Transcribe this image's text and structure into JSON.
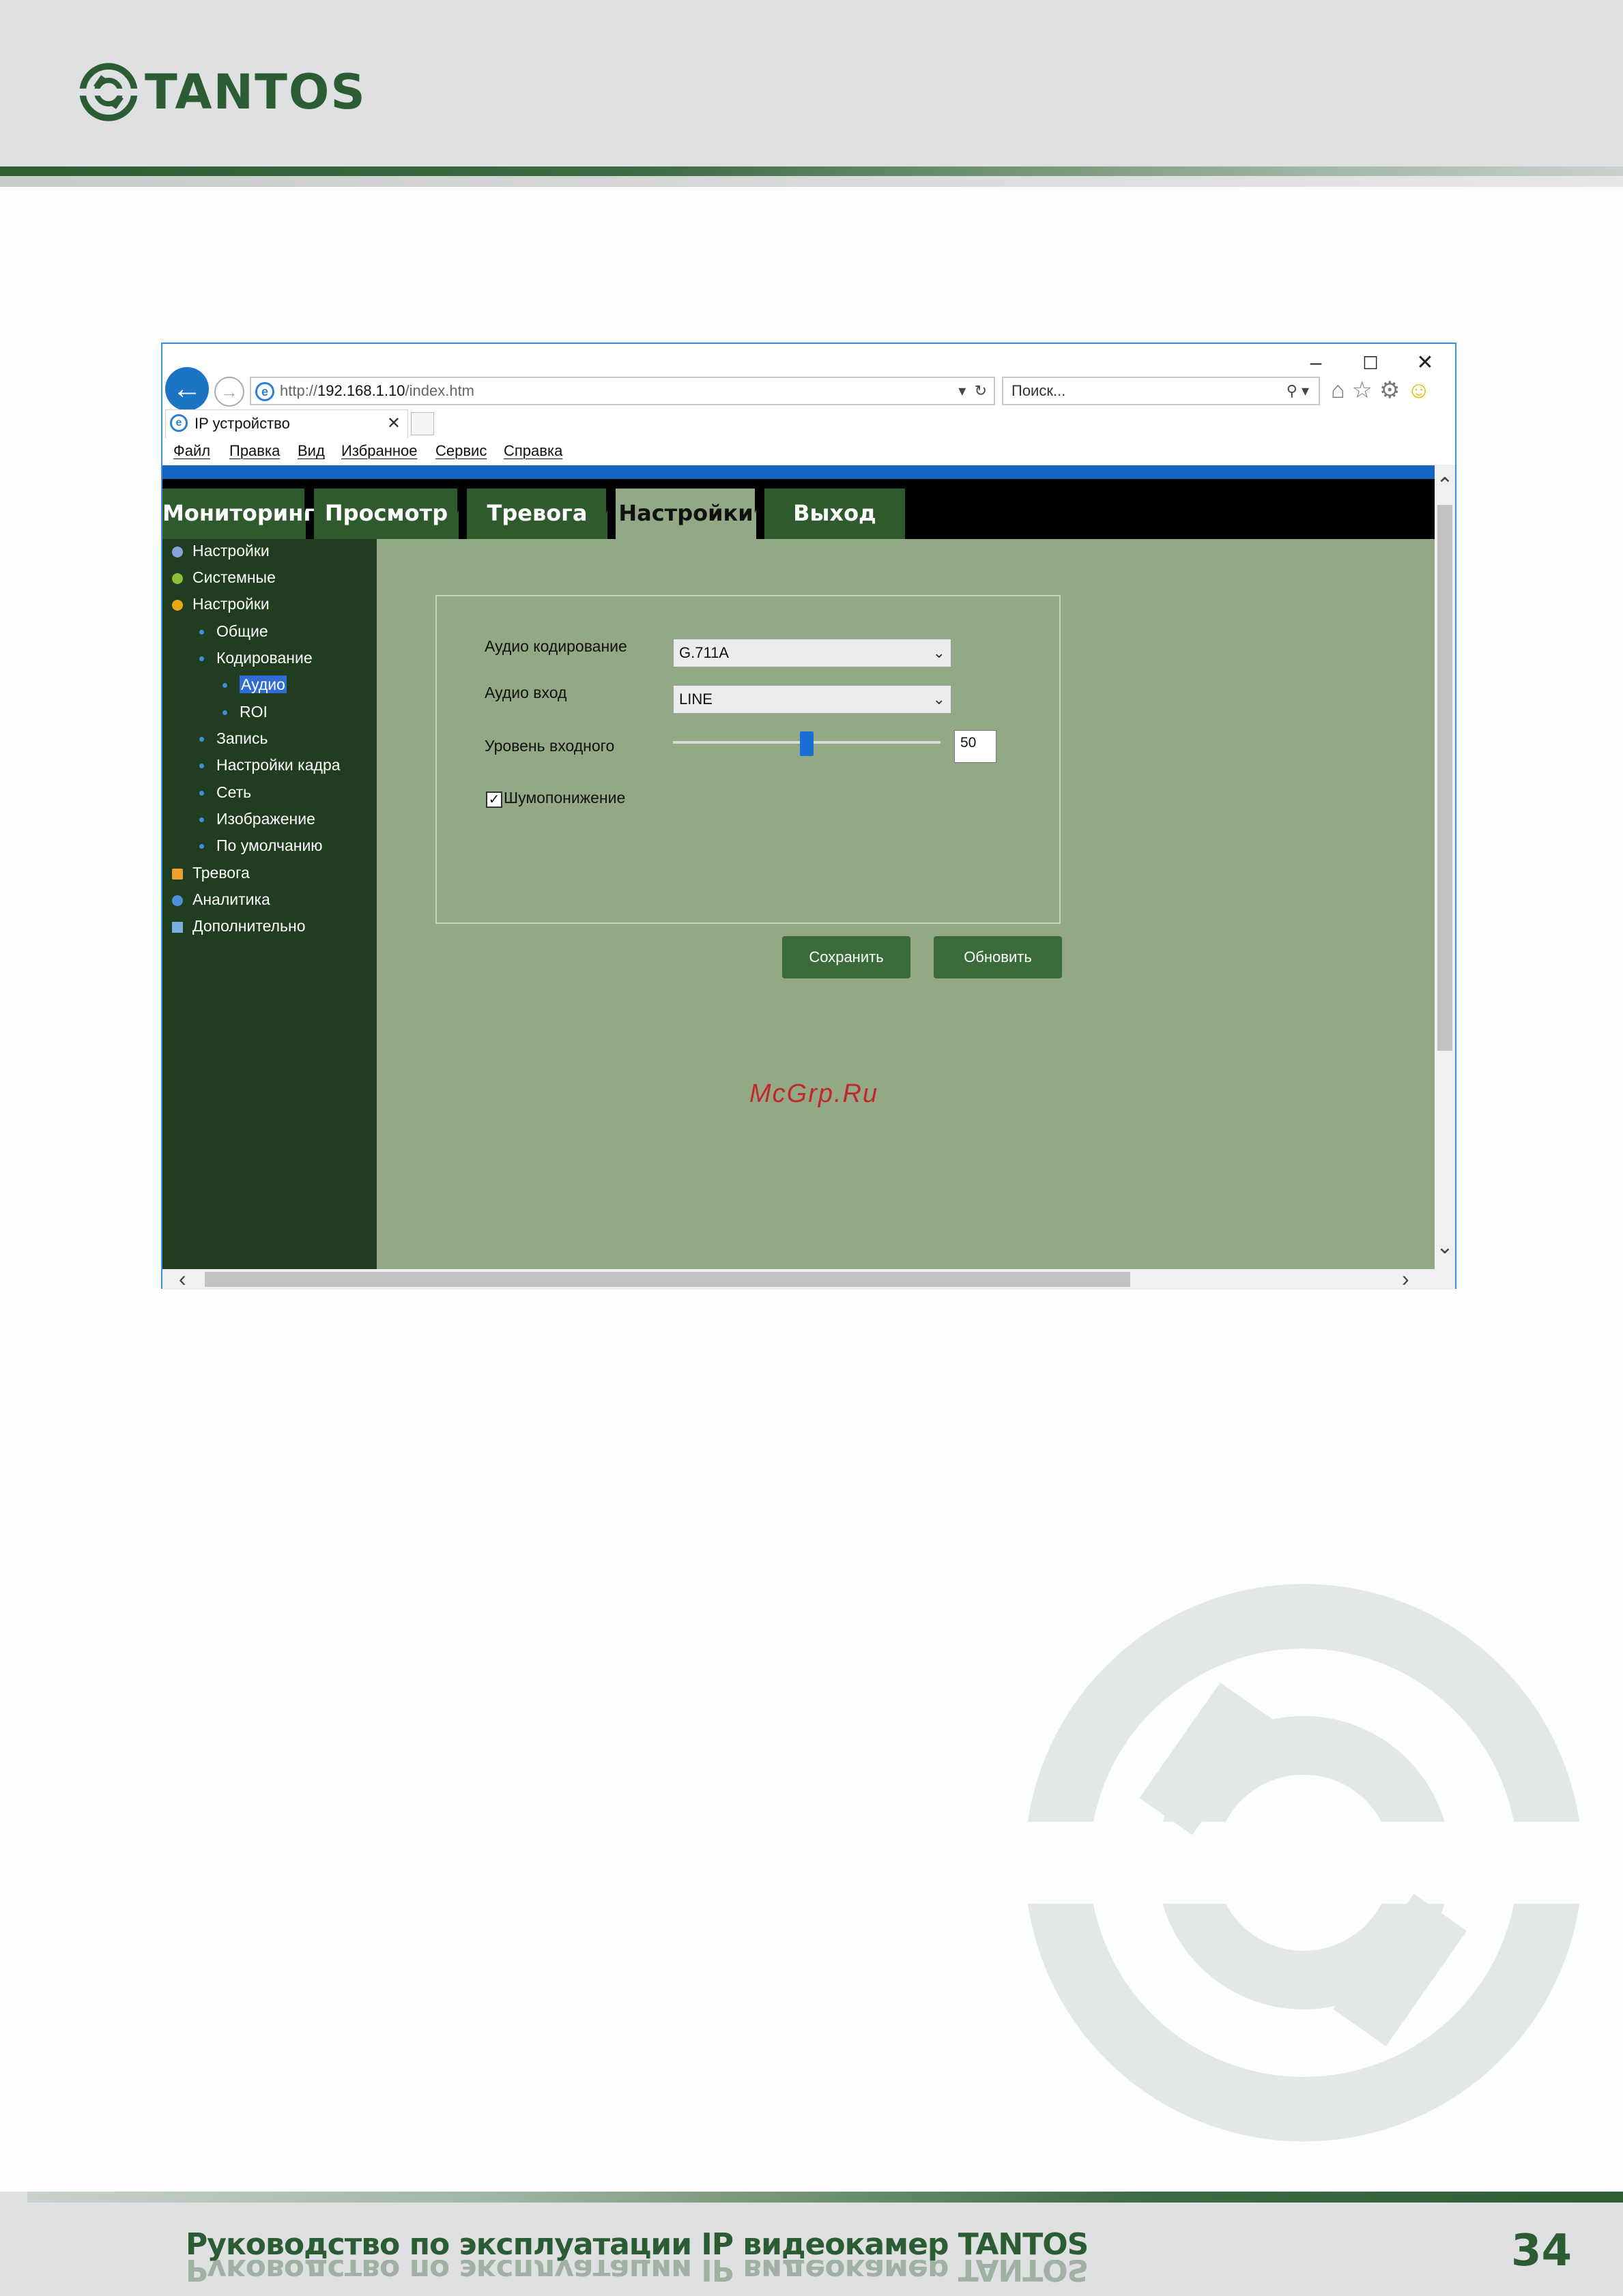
{
  "brand": {
    "name": "TANTOS",
    "accent": "#2c5c34"
  },
  "browser": {
    "window_controls": [
      "–",
      "☐",
      "✕"
    ],
    "url_prefix": "http://",
    "url_host": "192.168.1.10",
    "url_path": "/index.htm",
    "search_placeholder": "Поиск...",
    "tab_title": "IP устройство",
    "menu": [
      "Файл",
      "Правка",
      "Вид",
      "Избранное",
      "Сервис",
      "Справка"
    ]
  },
  "nav": {
    "tabs": [
      "Мониторинг",
      "Просмотр",
      "Тревога",
      "Настройки",
      "Выход"
    ],
    "active": "Настройки"
  },
  "sidebar": {
    "items": [
      {
        "label": "Настройки",
        "level": 0,
        "icon": "settings-icon"
      },
      {
        "label": "Системные",
        "level": 0,
        "icon": "info-icon"
      },
      {
        "label": "Настройки",
        "level": 0,
        "icon": "gear-icon"
      },
      {
        "label": "Общие",
        "level": 1
      },
      {
        "label": "Кодирование",
        "level": 1
      },
      {
        "label": "Аудио",
        "level": 2,
        "selected": true
      },
      {
        "label": "ROI",
        "level": 2
      },
      {
        "label": "Запись",
        "level": 1
      },
      {
        "label": "Настройки кадра",
        "level": 1
      },
      {
        "label": "Сеть",
        "level": 1
      },
      {
        "label": "Изображение",
        "level": 1
      },
      {
        "label": "По умолчанию",
        "level": 1
      },
      {
        "label": "Тревога",
        "level": 0,
        "icon": "bell-icon"
      },
      {
        "label": "Аналитика",
        "level": 0,
        "icon": "analytics-icon"
      },
      {
        "label": "Дополнительно",
        "level": 0,
        "icon": "tools-icon"
      }
    ]
  },
  "form": {
    "audio_encoding_label": "Аудио кодирование",
    "audio_encoding_value": "G.711A",
    "audio_input_label": "Аудио вход",
    "audio_input_value": "LINE",
    "input_level_label": "Уровень входного",
    "input_level_value": "50",
    "input_level_fraction": 0.5,
    "noise_reduction_label": "Шумопонижение",
    "noise_reduction_checked": true,
    "save_label": "Сохранить",
    "refresh_label": "Обновить"
  },
  "watermark": "McGrp.Ru",
  "footer": {
    "title": "Руководство по эксплуатации IP видеокамер TANTOS",
    "page_number": "34"
  }
}
